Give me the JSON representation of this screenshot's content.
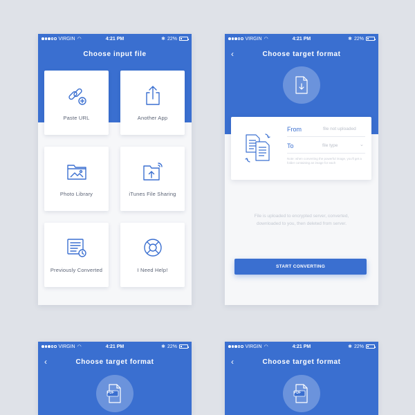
{
  "status_bar": {
    "carrier": "VIRGIN",
    "time": "4:21 PM",
    "battery": "22%"
  },
  "screen1": {
    "title": "Choose input file",
    "tiles": [
      {
        "label": "Paste URL",
        "icon": "link-add-icon"
      },
      {
        "label": "Another App",
        "icon": "share-icon"
      },
      {
        "label": "Photo Library",
        "icon": "photo-folder-icon"
      },
      {
        "label": "iTunes File Sharing",
        "icon": "folder-wireless-icon"
      },
      {
        "label": "Previously Converted",
        "icon": "history-document-icon"
      },
      {
        "label": "I Need Help!",
        "icon": "lifebuoy-icon"
      }
    ]
  },
  "screen2": {
    "title": "Choose target format",
    "from_label": "From",
    "from_value": "file not uploaded",
    "to_label": "To",
    "to_placeholder": "file type",
    "note": "Note: when converting the powerful image, you'll get a folder containing an image for each",
    "info": "File is uploaded to encrypted server, converted, downloaded to you, then deleted from server.",
    "button_label": "START CONVERTING"
  },
  "screen3": {
    "title": "Choose target format",
    "badge": "PDF"
  },
  "screen4": {
    "title": "Choose target format",
    "badge": "PDF"
  },
  "colors": {
    "primary": "#3a6fd0",
    "background": "#dfe2e8",
    "panel": "#f6f7f9"
  }
}
